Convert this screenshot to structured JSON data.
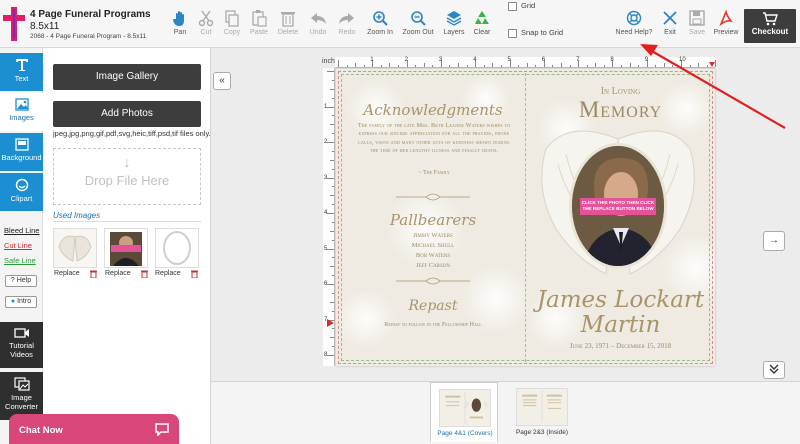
{
  "product": {
    "title": "4 Page Funeral Programs",
    "size": "8.5x11",
    "sku": "2068 - 4 Page Funeral Program - 8.5x11"
  },
  "toolbar": {
    "tools": [
      {
        "label": "Pan",
        "icon": "hand-icon",
        "enabled": true
      },
      {
        "label": "Cut",
        "icon": "scissors-icon",
        "enabled": false
      },
      {
        "label": "Copy",
        "icon": "copy-icon",
        "enabled": false
      },
      {
        "label": "Paste",
        "icon": "paste-icon",
        "enabled": false
      },
      {
        "label": "Delete",
        "icon": "trash-icon",
        "enabled": false
      },
      {
        "label": "Undo",
        "icon": "undo-icon",
        "enabled": false
      },
      {
        "label": "Redo",
        "icon": "redo-icon",
        "enabled": false
      },
      {
        "label": "Zoom In",
        "icon": "zoom-in-icon",
        "enabled": true
      },
      {
        "label": "Zoom Out",
        "icon": "zoom-out-icon",
        "enabled": true
      },
      {
        "label": "Layers",
        "icon": "layers-icon",
        "enabled": true
      },
      {
        "label": "Clear",
        "icon": "recycle-icon",
        "enabled": true
      }
    ],
    "grid_label": "Grid",
    "snap_label": "Snap to Grid",
    "help_label": "Need Help?",
    "exit_label": "Exit",
    "save_label": "Save",
    "preview_label": "Preview",
    "checkout_label": "Checkout"
  },
  "leftnav": {
    "text_label": "Text",
    "images_label": "Images",
    "background_label": "Background",
    "clipart_label": "Clipart",
    "bleed_line": "Bleed Line",
    "cut_line": "Cut Line",
    "safe_line": "Safe Line",
    "help_btn": "? Help",
    "intro_btn": "Intro",
    "tutorial_label": "Tutorial Videos",
    "converter_label": "Image Converter"
  },
  "panel": {
    "gallery_btn": "Image Gallery",
    "add_photos_btn": "Add Photos",
    "file_types": "jpeg,jpg,png,gif,pdf,svg,heic,tiff,psd,tif files only.",
    "drop_text": "Drop File Here",
    "used_images_label": "Used Images",
    "replace_label": "Replace",
    "chat_label": "Chat Now"
  },
  "ruler": {
    "unit": "inch",
    "marks": [
      "1",
      "2",
      "3",
      "4",
      "5",
      "6",
      "7",
      "8",
      "9",
      "10",
      "11"
    ],
    "v_marks": [
      "1",
      "2",
      "3",
      "4",
      "5",
      "6",
      "7",
      "8"
    ]
  },
  "program": {
    "ack_title": "Acknowledgments",
    "ack_text": "The family of the late Mrs. Beth Leanne Waters wishes to express our sincere appreciation for all the prayers, phone calls, visits and many other acts of kindness shown during the time of her lengthy illness and finally death.",
    "ack_sign": "~ The Family",
    "pall_title": "Pallbearers",
    "pallbearers": [
      "Jimmy Waters",
      "Michael Shull",
      "Bob Waters",
      "Jeff Carson"
    ],
    "repast_title": "Repast",
    "repast_text": "Repast to follow in the Fellowship Hall",
    "in_loving": "In Loving",
    "memory": "Memory",
    "photo_tag": "CLICK THIS PHOTO THEN CLICK THE REPLACE BUTTON BELOW",
    "first_name": "James Lockart",
    "last_name": "Martin",
    "dates": "June 23, 1971 – December 15, 2018"
  },
  "pages": [
    {
      "label": "Page 4&1 (Covers)",
      "active": true
    },
    {
      "label": "Page 2&3 (Inside)",
      "active": false
    }
  ],
  "colors": {
    "accent_blue": "#1b8fd1",
    "dark_button": "#3d3d3d",
    "chat_pink": "#d9467a",
    "annotation_red": "#e02020",
    "gold_text": "#a9946a"
  }
}
